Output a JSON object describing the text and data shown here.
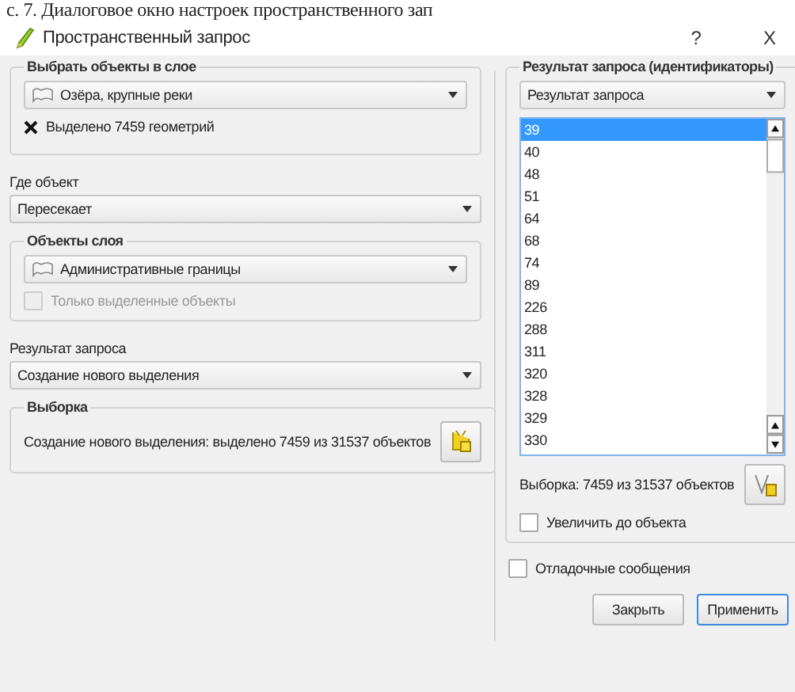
{
  "caption": "с. 7. Диалоговое окно настроек пространственного зап",
  "window": {
    "title": "Пространственный запрос",
    "help": "?",
    "close": "X"
  },
  "source_group": {
    "title": "Выбрать объекты в слое",
    "layer": "Озёра, крупные реки",
    "selection_note": "Выделено 7459 геометрий"
  },
  "where": {
    "label": "Где объект",
    "value": "Пересекает"
  },
  "target_group": {
    "title": "Объекты слоя",
    "layer": "Административные границы",
    "only_selected": {
      "label": "Только выделенные объекты",
      "checked": false,
      "disabled": true
    }
  },
  "result": {
    "label": "Результат запроса",
    "value": "Создание нового выделения"
  },
  "selection_group": {
    "title": "Выборка",
    "text": "Создание нового выделения: выделено 7459 из 31537 объектов"
  },
  "ids_group": {
    "title": "Результат запроса (идентификаторы)",
    "combo": "Результат запроса",
    "items": [
      {
        "label": "39",
        "selected": true
      },
      {
        "label": "40",
        "selected": false
      },
      {
        "label": "48",
        "selected": false
      },
      {
        "label": "51",
        "selected": false
      },
      {
        "label": "64",
        "selected": false
      },
      {
        "label": "68",
        "selected": false
      },
      {
        "label": "74",
        "selected": false
      },
      {
        "label": "89",
        "selected": false
      },
      {
        "label": "226",
        "selected": false
      },
      {
        "label": "288",
        "selected": false
      },
      {
        "label": "311",
        "selected": false
      },
      {
        "label": "320",
        "selected": false
      },
      {
        "label": "328",
        "selected": false
      },
      {
        "label": "329",
        "selected": false
      },
      {
        "label": "330",
        "selected": false
      }
    ],
    "summary": "Выборка: 7459 из 31537 объектов",
    "zoom_checkbox": {
      "label": "Увеличить до объекта",
      "checked": false,
      "disabled": false
    }
  },
  "debug_checkbox": {
    "label": "Отладочные сообщения",
    "checked": false,
    "disabled": false
  },
  "buttons": [
    {
      "label": "Закрыть",
      "default": false
    },
    {
      "label": "Применить",
      "default": true
    }
  ]
}
